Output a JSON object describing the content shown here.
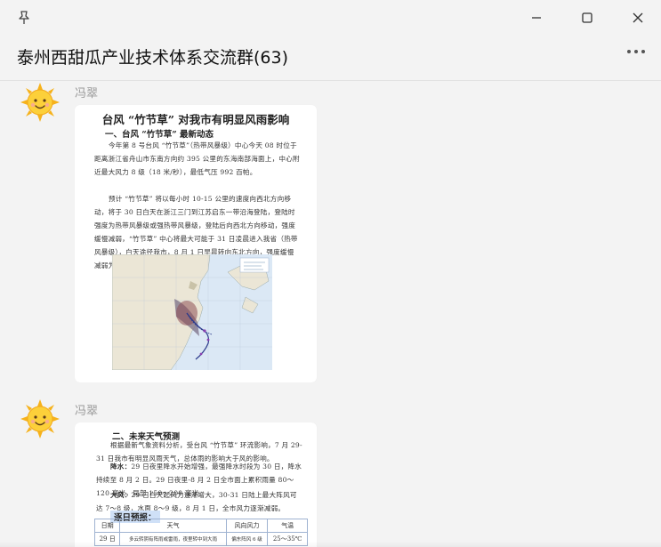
{
  "window": {
    "pin_icon": "pin-icon",
    "minimize_icon": "minimize-icon",
    "maximize_icon": "maximize-icon",
    "close_icon": "close-icon"
  },
  "header": {
    "title": "泰州西甜瓜产业技术体系交流群(63)",
    "more_icon": "more-icon"
  },
  "messages": [
    {
      "sender": "冯翠",
      "avatar_icon": "sun-avatar-icon",
      "doc": {
        "title": "台风 “竹节草” 对我市有明显风雨影响",
        "section": "一、台风 “竹节草” 最新动态",
        "para1": "今年第 8 号台风 “竹节草”（热带风暴级）中心今天 08 时位于距离浙江省舟山市东南方向约 395 公里的东海南部海面上，中心附近最大风力 8 级（18 米/秒），最低气压 992 百帕。",
        "para2": "预计 “竹节草” 将以每小时 10-15 公里的速度向西北方向移动，将于 30 日白天在浙江三门到江苏启东一带沿海登陆，登陆时强度为热带风暴级或强热带风暴级，登陆后向西北方向移动，强度缓慢减弱，“竹节草” 中心将最大可能于 31 日凌晨进入我省（热带风暴级），白天途径我市，8 月 1 日早晨转向东北方向，强度缓慢减弱为热带低压，2 日移出我省。"
      }
    },
    {
      "sender": "冯翠",
      "avatar_icon": "sun-avatar-icon",
      "doc": {
        "section": "二、未来天气预测",
        "para1": "根据最新气象资料分析，受台风 “竹节草” 环流影响，7 月 29-31 日我市有明显风雨天气，总体雨的影响大于风的影响。",
        "rain_label": "降水：",
        "rain_text": "29 日夜里降水开始增强，最强降水时段为 30 日，降水持续至 8 月 2 日。29 日夜里-8 月 2 日全市面上累积雨量 80～120 毫米，局部 150～200 毫米。",
        "wind_label": "大风：",
        "wind_text": "29 日白天起风力逐渐增大，30-31 日陆上最大阵风可达 7～8 级，水面 8～9 级，8 月 1 日，全市风力逐渐减弱。",
        "forecast_label": "逐日预报：",
        "table": {
          "headers": [
            "日期",
            "天气",
            "风向风力",
            "气温"
          ],
          "rows": [
            [
              "29 日",
              "多云转阴有阵雨或雷雨，夜里转中到大雨",
              "偏东阵风 6 级",
              "25～35℃"
            ]
          ]
        }
      }
    }
  ]
}
